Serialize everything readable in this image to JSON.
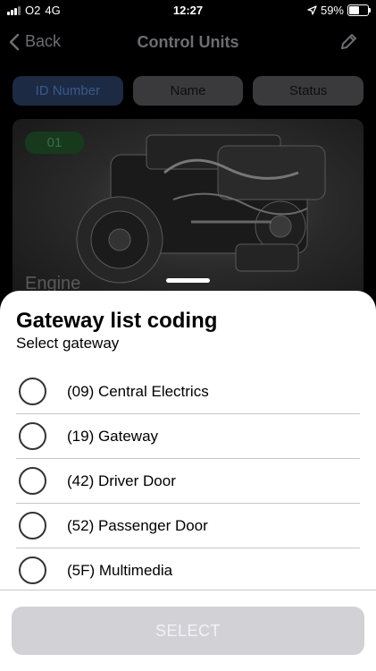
{
  "status_bar": {
    "carrier": "O2",
    "network": "4G",
    "time": "12:27",
    "battery": "59%"
  },
  "navbar": {
    "back_label": "Back",
    "title": "Control Units"
  },
  "segments": [
    {
      "label": "ID Number",
      "active": true
    },
    {
      "label": "Name",
      "active": false
    },
    {
      "label": "Status",
      "active": false
    }
  ],
  "card": {
    "badge": "01",
    "label": "Engine"
  },
  "sheet": {
    "title": "Gateway list coding",
    "subtitle": "Select gateway",
    "options": [
      {
        "label": "(09) Central Electrics"
      },
      {
        "label": "(19) Gateway"
      },
      {
        "label": "(42) Driver Door"
      },
      {
        "label": "(52) Passenger Door"
      },
      {
        "label": "(5F) Multimedia"
      }
    ],
    "select_label": "SELECT"
  },
  "colors": {
    "accent_active_segment": "#1c2a44",
    "badge_green": "#173a1d",
    "button_disabled": "#d1d1d6"
  }
}
